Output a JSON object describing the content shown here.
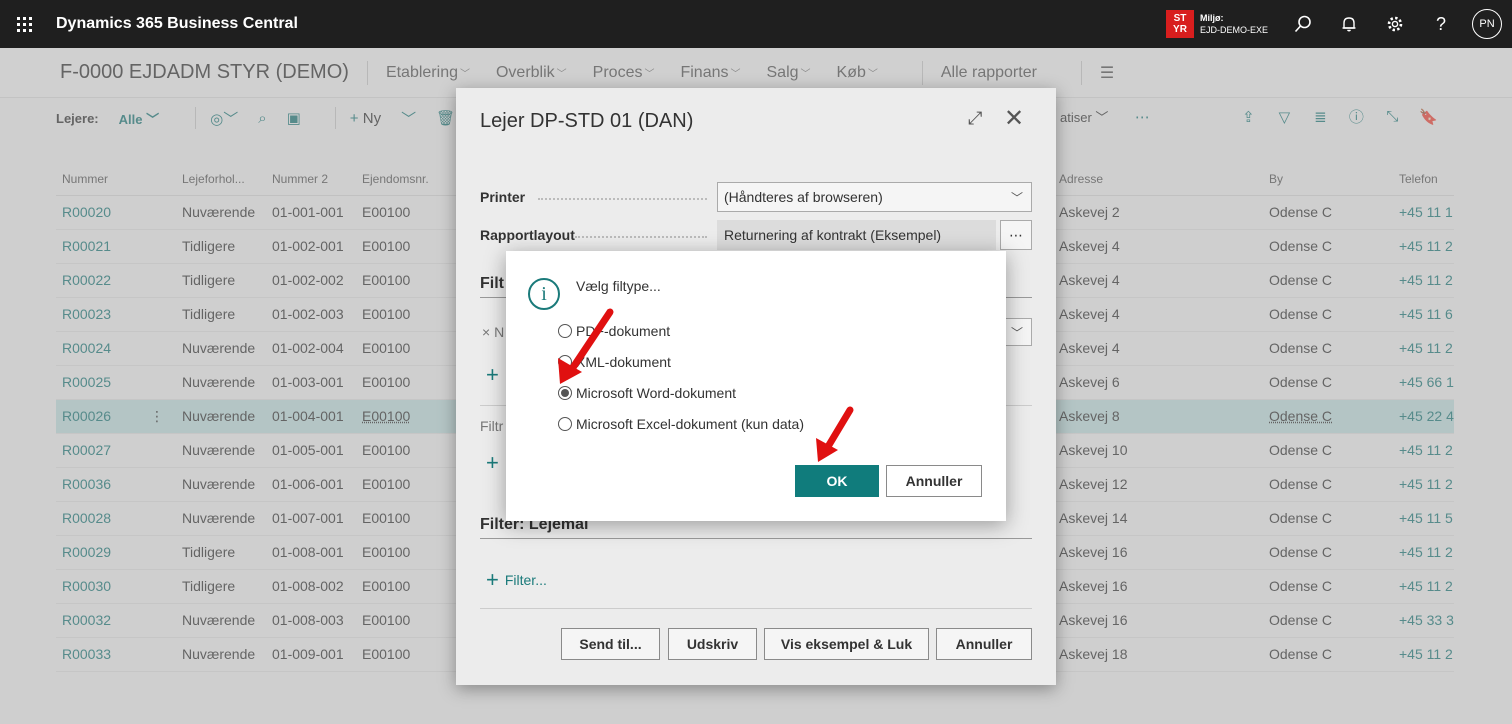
{
  "topbar": {
    "app_title": "Dynamics 365 Business Central",
    "env_badge_line1": "ST",
    "env_badge_line2": "YR",
    "env_label": "Miljø:",
    "env_name": "EJD-DEMO-EXE",
    "user_initials": "PN"
  },
  "header": {
    "company": "F-0000 EJDADM STYR (DEMO)",
    "nav": [
      "Etablering",
      "Overblik",
      "Proces",
      "Finans",
      "Salg",
      "Køb"
    ],
    "all_reports": "Alle rapporter"
  },
  "actionbar": {
    "label": "Lejere:",
    "filter_value": "Alle",
    "new_label": "Ny",
    "automate_label": "atiser"
  },
  "list": {
    "columns": [
      "Nummer",
      "Lejeforhol...",
      "Nummer 2",
      "Ejendomsnr.",
      "Adresse",
      "By",
      "Telefon"
    ],
    "rows": [
      [
        "R00020",
        "Nuværende",
        "01-001-001",
        "E00100",
        "Askevej 2",
        "Odense C",
        "+45 11 1"
      ],
      [
        "R00021",
        "Tidligere",
        "01-002-001",
        "E00100",
        "Askevej 4",
        "Odense C",
        "+45 11 2"
      ],
      [
        "R00022",
        "Tidligere",
        "01-002-002",
        "E00100",
        "Askevej 4",
        "Odense C",
        "+45 11 2"
      ],
      [
        "R00023",
        "Tidligere",
        "01-002-003",
        "E00100",
        "Askevej 4",
        "Odense C",
        "+45 11 6"
      ],
      [
        "R00024",
        "Nuværende",
        "01-002-004",
        "E00100",
        "Askevej 4",
        "Odense C",
        "+45 11 2"
      ],
      [
        "R00025",
        "Nuværende",
        "01-003-001",
        "E00100",
        "Askevej 6",
        "Odense C",
        "+45 66 1"
      ],
      [
        "R00026",
        "Nuværende",
        "01-004-001",
        "E00100",
        "Askevej 8",
        "Odense C",
        "+45 22 4"
      ],
      [
        "R00027",
        "Nuværende",
        "01-005-001",
        "E00100",
        "Askevej 10",
        "Odense C",
        "+45 11 2"
      ],
      [
        "R00036",
        "Nuværende",
        "01-006-001",
        "E00100",
        "Askevej 12",
        "Odense C",
        "+45 11 2"
      ],
      [
        "R00028",
        "Nuværende",
        "01-007-001",
        "E00100",
        "Askevej 14",
        "Odense C",
        "+45 11 5"
      ],
      [
        "R00029",
        "Tidligere",
        "01-008-001",
        "E00100",
        "Askevej 16",
        "Odense C",
        "+45 11 2"
      ],
      [
        "R00030",
        "Tidligere",
        "01-008-002",
        "E00100",
        "Askevej 16",
        "Odense C",
        "+45 11 2"
      ],
      [
        "R00032",
        "Nuværende",
        "01-008-003",
        "E00100",
        "Askevej 16",
        "Odense C",
        "+45 33 3"
      ],
      [
        "R00033",
        "Nuværende",
        "01-009-001",
        "E00100",
        "Askevej 18",
        "Odense C",
        "+45 11 2"
      ]
    ],
    "selected_index": 6
  },
  "report_dialog": {
    "title": "Lejer DP-STD 01 (DAN)",
    "printer_label": "Printer",
    "printer_value": "(Håndteres af browseren)",
    "layout_label": "Rapportlayout",
    "layout_value": "Returnering af kontrakt (Eksempel)",
    "filter_section_partial": "Filt",
    "filter_row_partial": "N",
    "filter_sub_partial": "Filtr",
    "filter_lejemaal_title": "Filter: Lejemål",
    "add_filter_label": "Filter...",
    "btn_send": "Send til...",
    "btn_print": "Udskriv",
    "btn_preview": "Vis eksempel & Luk",
    "btn_cancel": "Annuller"
  },
  "filetype_dialog": {
    "prompt": "Vælg filtype...",
    "options": [
      "PDF-dokument",
      "XML-dokument",
      "Microsoft Word-dokument",
      "Microsoft Excel-dokument (kun data)"
    ],
    "selected_index": 2,
    "ok_label": "OK",
    "cancel_label": "Annuller"
  },
  "colors": {
    "accent": "#107c7c",
    "link": "#1a7a7a",
    "topbar": "#1f1f1f",
    "env_badge": "#d81e1e",
    "annotation_arrow": "#e01010",
    "selected_row": "#c5e3e3"
  }
}
